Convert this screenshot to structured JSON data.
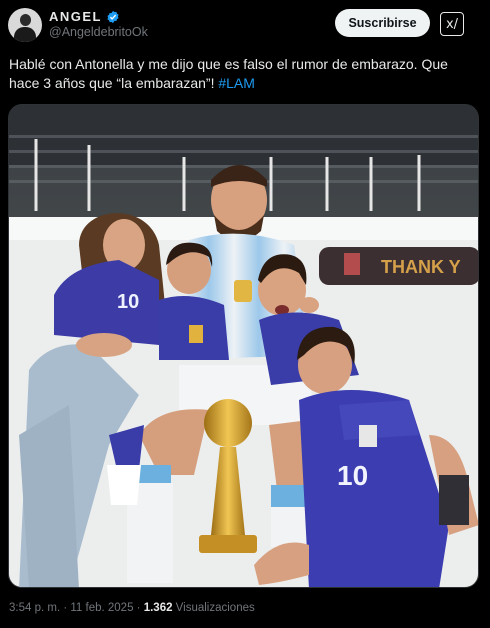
{
  "author": {
    "display_name": "ANGEL",
    "handle": "@AngeldebritoOk",
    "verified_icon": "verified-badge-icon",
    "badge_color": "#1d9bf0"
  },
  "actions": {
    "subscribe_label": "Suscribirse",
    "grok_label": "x/"
  },
  "tweet": {
    "text_main": "Hablé con Antonella y me dijo que es falso el rumor de embarazo. Que hace 3 años que “la embarazan”! ",
    "hashtag": "#LAM"
  },
  "photo": {
    "banner_text": "THANK Y",
    "jersey_numbers": [
      "10",
      "10"
    ]
  },
  "meta": {
    "time": "3:54 p. m.",
    "sep1": " · ",
    "date": "11 feb. 2025",
    "sep2": " · ",
    "views_count": "1.362",
    "views_label": " Visualizaciones"
  }
}
